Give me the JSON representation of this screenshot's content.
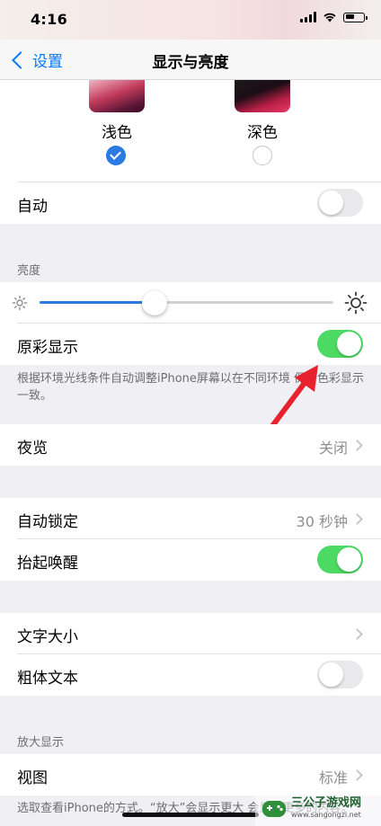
{
  "status_bar": {
    "time": "4:16",
    "battery_level": 0.55
  },
  "nav": {
    "back_label": "设置",
    "title": "显示与亮度"
  },
  "appearance": {
    "light_label": "浅色",
    "dark_label": "深色",
    "selected": "light"
  },
  "auto_row": {
    "label": "自动",
    "enabled": false
  },
  "brightness": {
    "header": "亮度",
    "level": 0.39
  },
  "true_tone": {
    "label": "原彩显示",
    "enabled": true,
    "footer": "根据环境光线条件自动调整iPhone屏幕以在不同环境  保持色彩显示一致。"
  },
  "night_shift": {
    "label": "夜览",
    "value": "关闭"
  },
  "auto_lock": {
    "label": "自动锁定",
    "value": "30 秒钟"
  },
  "raise_to_wake": {
    "label": "抬起唤醒",
    "enabled": true
  },
  "text_size": {
    "label": "文字大小"
  },
  "bold_text": {
    "label": "粗体文本",
    "enabled": false
  },
  "zoom": {
    "header": "放大显示",
    "view_label": "视图",
    "view_value": "标准",
    "footer": "选取查看iPhone的方式。“放大”会显示更大  会显示更多的内容。"
  },
  "watermark": {
    "title": "三公子游戏网",
    "url": "www.sangongzi.net"
  },
  "colors": {
    "accent": "#007aff",
    "toggle_on": "#4cd964",
    "arrow": "#e8212f"
  }
}
